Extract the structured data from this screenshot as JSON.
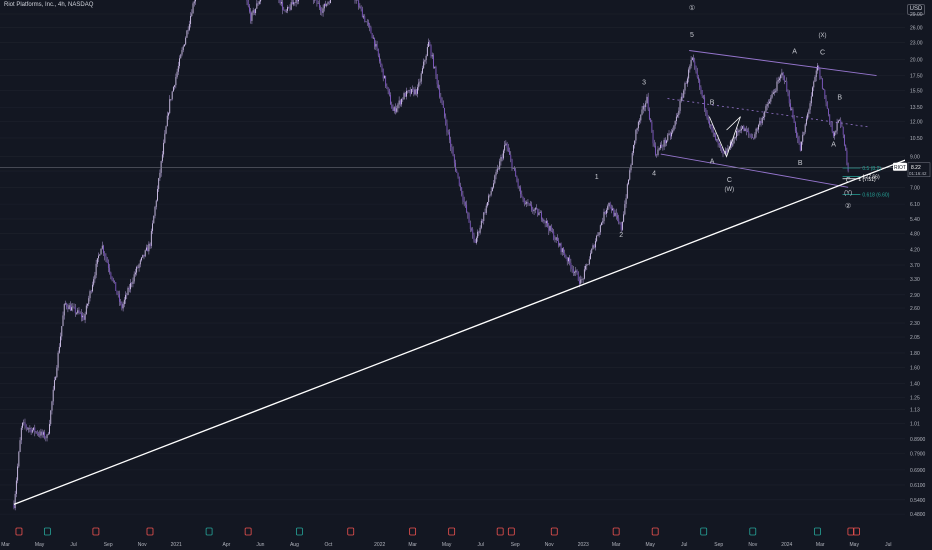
{
  "header": {
    "title": "Riot Platforms, Inc., 4h, NASDAQ",
    "currency": "USD"
  },
  "colors": {
    "background": "#131722",
    "candles": "#b39ddb",
    "trendline": "#ffffff",
    "channel": "#9575cd",
    "fib": "#26a69a",
    "axis_text": "#b2b5be",
    "grid": "#1e222d"
  },
  "chart_data": {
    "type": "candlestick",
    "title": "Riot Platforms, Inc., 4h, NASDAQ",
    "y_scale": "log",
    "y_ticks": [
      0.48,
      0.54,
      0.61,
      0.69,
      0.79,
      0.89,
      1.01,
      1.13,
      1.25,
      1.4,
      1.6,
      1.8,
      2.05,
      2.3,
      2.6,
      2.9,
      3.3,
      3.7,
      4.2,
      4.8,
      5.4,
      6.1,
      7.0,
      8.0,
      9.0,
      10.5,
      12.0,
      13.5,
      15.5,
      17.5,
      20.0,
      23.0,
      26.0,
      29.0
    ],
    "y_tick_labels": [
      "0.4800",
      "0.5400",
      "0.6100",
      "0.6900",
      "0.7900",
      "0.8900",
      "1.01",
      "1.13",
      "1.25",
      "1.40",
      "1.60",
      "1.80",
      "2.05",
      "2.30",
      "2.60",
      "2.90",
      "3.30",
      "3.70",
      "4.20",
      "4.80",
      "5.40",
      "6.10",
      "7.00",
      "8.00",
      "9.00",
      "10.50",
      "12.00",
      "13.50",
      "15.50",
      "17.50",
      "20.00",
      "23.00",
      "26.00",
      "29.00"
    ],
    "x_ticks": [
      "Mar",
      "May",
      "Jul",
      "Sep",
      "Nov",
      "2021",
      "Apr",
      "Jun",
      "Aug",
      "Oct",
      "2022",
      "Mar",
      "May",
      "Jul",
      "Sep",
      "Nov",
      "2023",
      "Mar",
      "May",
      "Jul",
      "Sep",
      "Nov",
      "2024",
      "Mar",
      "May",
      "Jul"
    ],
    "last_price": {
      "symbol": "RIOT",
      "value": "8.22",
      "countdown": "01:16:42"
    },
    "anchors": [
      {
        "date": "2020-03-16",
        "price": 0.52
      },
      {
        "date": "2020-03-30",
        "price": 1.0
      },
      {
        "date": "2020-05-15",
        "price": 0.9
      },
      {
        "date": "2020-06-15",
        "price": 2.7
      },
      {
        "date": "2020-07-20",
        "price": 2.4
      },
      {
        "date": "2020-08-20",
        "price": 4.4
      },
      {
        "date": "2020-09-25",
        "price": 2.6
      },
      {
        "date": "2020-10-20",
        "price": 3.5
      },
      {
        "date": "2020-11-15",
        "price": 4.4
      },
      {
        "date": "2020-12-20",
        "price": 14.0
      },
      {
        "date": "2021-01-20",
        "price": 25.0
      },
      {
        "date": "2021-02-18",
        "price": 45.0
      },
      {
        "date": "2021-03-15",
        "price": 40.0
      },
      {
        "date": "2021-04-10",
        "price": 40.0
      },
      {
        "date": "2021-05-01",
        "price": 36.0
      },
      {
        "date": "2021-05-15",
        "price": 28.0
      },
      {
        "date": "2021-06-20",
        "price": 40.0
      },
      {
        "date": "2021-07-15",
        "price": 29.0
      },
      {
        "date": "2021-08-20",
        "price": 36.0
      },
      {
        "date": "2021-09-20",
        "price": 30.0
      },
      {
        "date": "2021-11-01",
        "price": 40.0
      },
      {
        "date": "2021-11-15",
        "price": 34.0
      },
      {
        "date": "2021-12-20",
        "price": 24.0
      },
      {
        "date": "2022-01-25",
        "price": 13.0
      },
      {
        "date": "2022-02-15",
        "price": 15.0
      },
      {
        "date": "2022-03-10",
        "price": 15.5
      },
      {
        "date": "2022-03-30",
        "price": 23.0
      },
      {
        "date": "2022-05-15",
        "price": 8.5
      },
      {
        "date": "2022-06-20",
        "price": 4.4
      },
      {
        "date": "2022-08-15",
        "price": 10.0
      },
      {
        "date": "2022-09-15",
        "price": 6.2
      },
      {
        "date": "2022-10-20",
        "price": 5.5
      },
      {
        "date": "2022-12-28",
        "price": 3.2
      },
      {
        "date": "2023-02-15",
        "price": 6.2
      },
      {
        "date": "2023-03-10",
        "price": 5.0
      },
      {
        "date": "2023-04-05",
        "price": 11.0
      },
      {
        "date": "2023-04-25",
        "price": 14.5
      },
      {
        "date": "2023-05-10",
        "price": 9.2
      },
      {
        "date": "2023-06-10",
        "price": 11.0
      },
      {
        "date": "2023-07-15",
        "price": 20.0
      },
      {
        "date": "2023-08-20",
        "price": 11.0
      },
      {
        "date": "2023-09-10",
        "price": 9.0
      },
      {
        "date": "2023-10-10",
        "price": 11.5
      },
      {
        "date": "2023-11-01",
        "price": 10.5
      },
      {
        "date": "2023-12-25",
        "price": 18.0
      },
      {
        "date": "2024-01-25",
        "price": 9.5
      },
      {
        "date": "2024-02-25",
        "price": 18.8
      },
      {
        "date": "2024-03-05",
        "price": 16.0
      },
      {
        "date": "2024-03-25",
        "price": 10.5
      },
      {
        "date": "2024-04-05",
        "price": 12.5
      },
      {
        "date": "2024-04-20",
        "price": 8.2
      }
    ],
    "wave_labels": [
      {
        "text": "1",
        "date": "2023-01-25",
        "price": 7.5
      },
      {
        "text": "2",
        "date": "2023-03-10",
        "price": 4.65
      },
      {
        "text": "3",
        "date": "2023-04-20",
        "price": 16.3
      },
      {
        "text": "4",
        "date": "2023-05-08",
        "price": 7.7
      },
      {
        "text": "5",
        "date": "2023-07-15",
        "price": 24.0
      },
      {
        "text": "①",
        "date": "2023-07-15",
        "price": 30.0
      },
      {
        "text": "A",
        "date": "2023-08-20",
        "price": 8.5
      },
      {
        "text": "B",
        "date": "2023-08-20",
        "price": 13.8
      },
      {
        "text": "C",
        "date": "2023-09-20",
        "price": 7.3
      },
      {
        "text": "(W)",
        "date": "2023-09-20",
        "price": 6.8
      },
      {
        "text": "A",
        "date": "2024-01-15",
        "price": 21.0
      },
      {
        "text": "B",
        "date": "2024-01-25",
        "price": 8.4
      },
      {
        "text": "(X)",
        "date": "2024-03-05",
        "price": 24.0
      },
      {
        "text": "C",
        "date": "2024-03-05",
        "price": 20.8
      },
      {
        "text": "A",
        "date": "2024-03-25",
        "price": 9.8
      },
      {
        "text": "B",
        "date": "2024-04-05",
        "price": 14.4
      },
      {
        "text": "C",
        "date": "2024-04-20",
        "price": 7.3
      },
      {
        "text": "(Y)",
        "date": "2024-04-20",
        "price": 6.6
      },
      {
        "text": "②",
        "date": "2024-04-20",
        "price": 5.9
      }
    ],
    "fib_levels": [
      {
        "label": "0.5 (8.2)",
        "price": 8.2
      },
      {
        "label": "1 (7.51)",
        "price": 7.51
      },
      {
        "label": "1 (7.66)",
        "price": 7.66
      },
      {
        "label": "0.618 (6.60)",
        "price": 6.6
      }
    ],
    "trendline": [
      {
        "date": "2020-03-16",
        "price": 0.52
      },
      {
        "date": "2024-07-31",
        "price": 9.3
      }
    ],
    "channel": [
      [
        {
          "date": "2023-07-10",
          "price": 21.5
        },
        {
          "date": "2024-06-10",
          "price": 17.5
        }
      ],
      [
        {
          "date": "2023-05-20",
          "price": 9.2
        },
        {
          "date": "2024-04-20",
          "price": 7.0
        }
      ]
    ],
    "date_range": {
      "start": "2020-02-20",
      "end": "2024-07-31"
    },
    "price_range": [
      0.45,
      32.0
    ]
  }
}
